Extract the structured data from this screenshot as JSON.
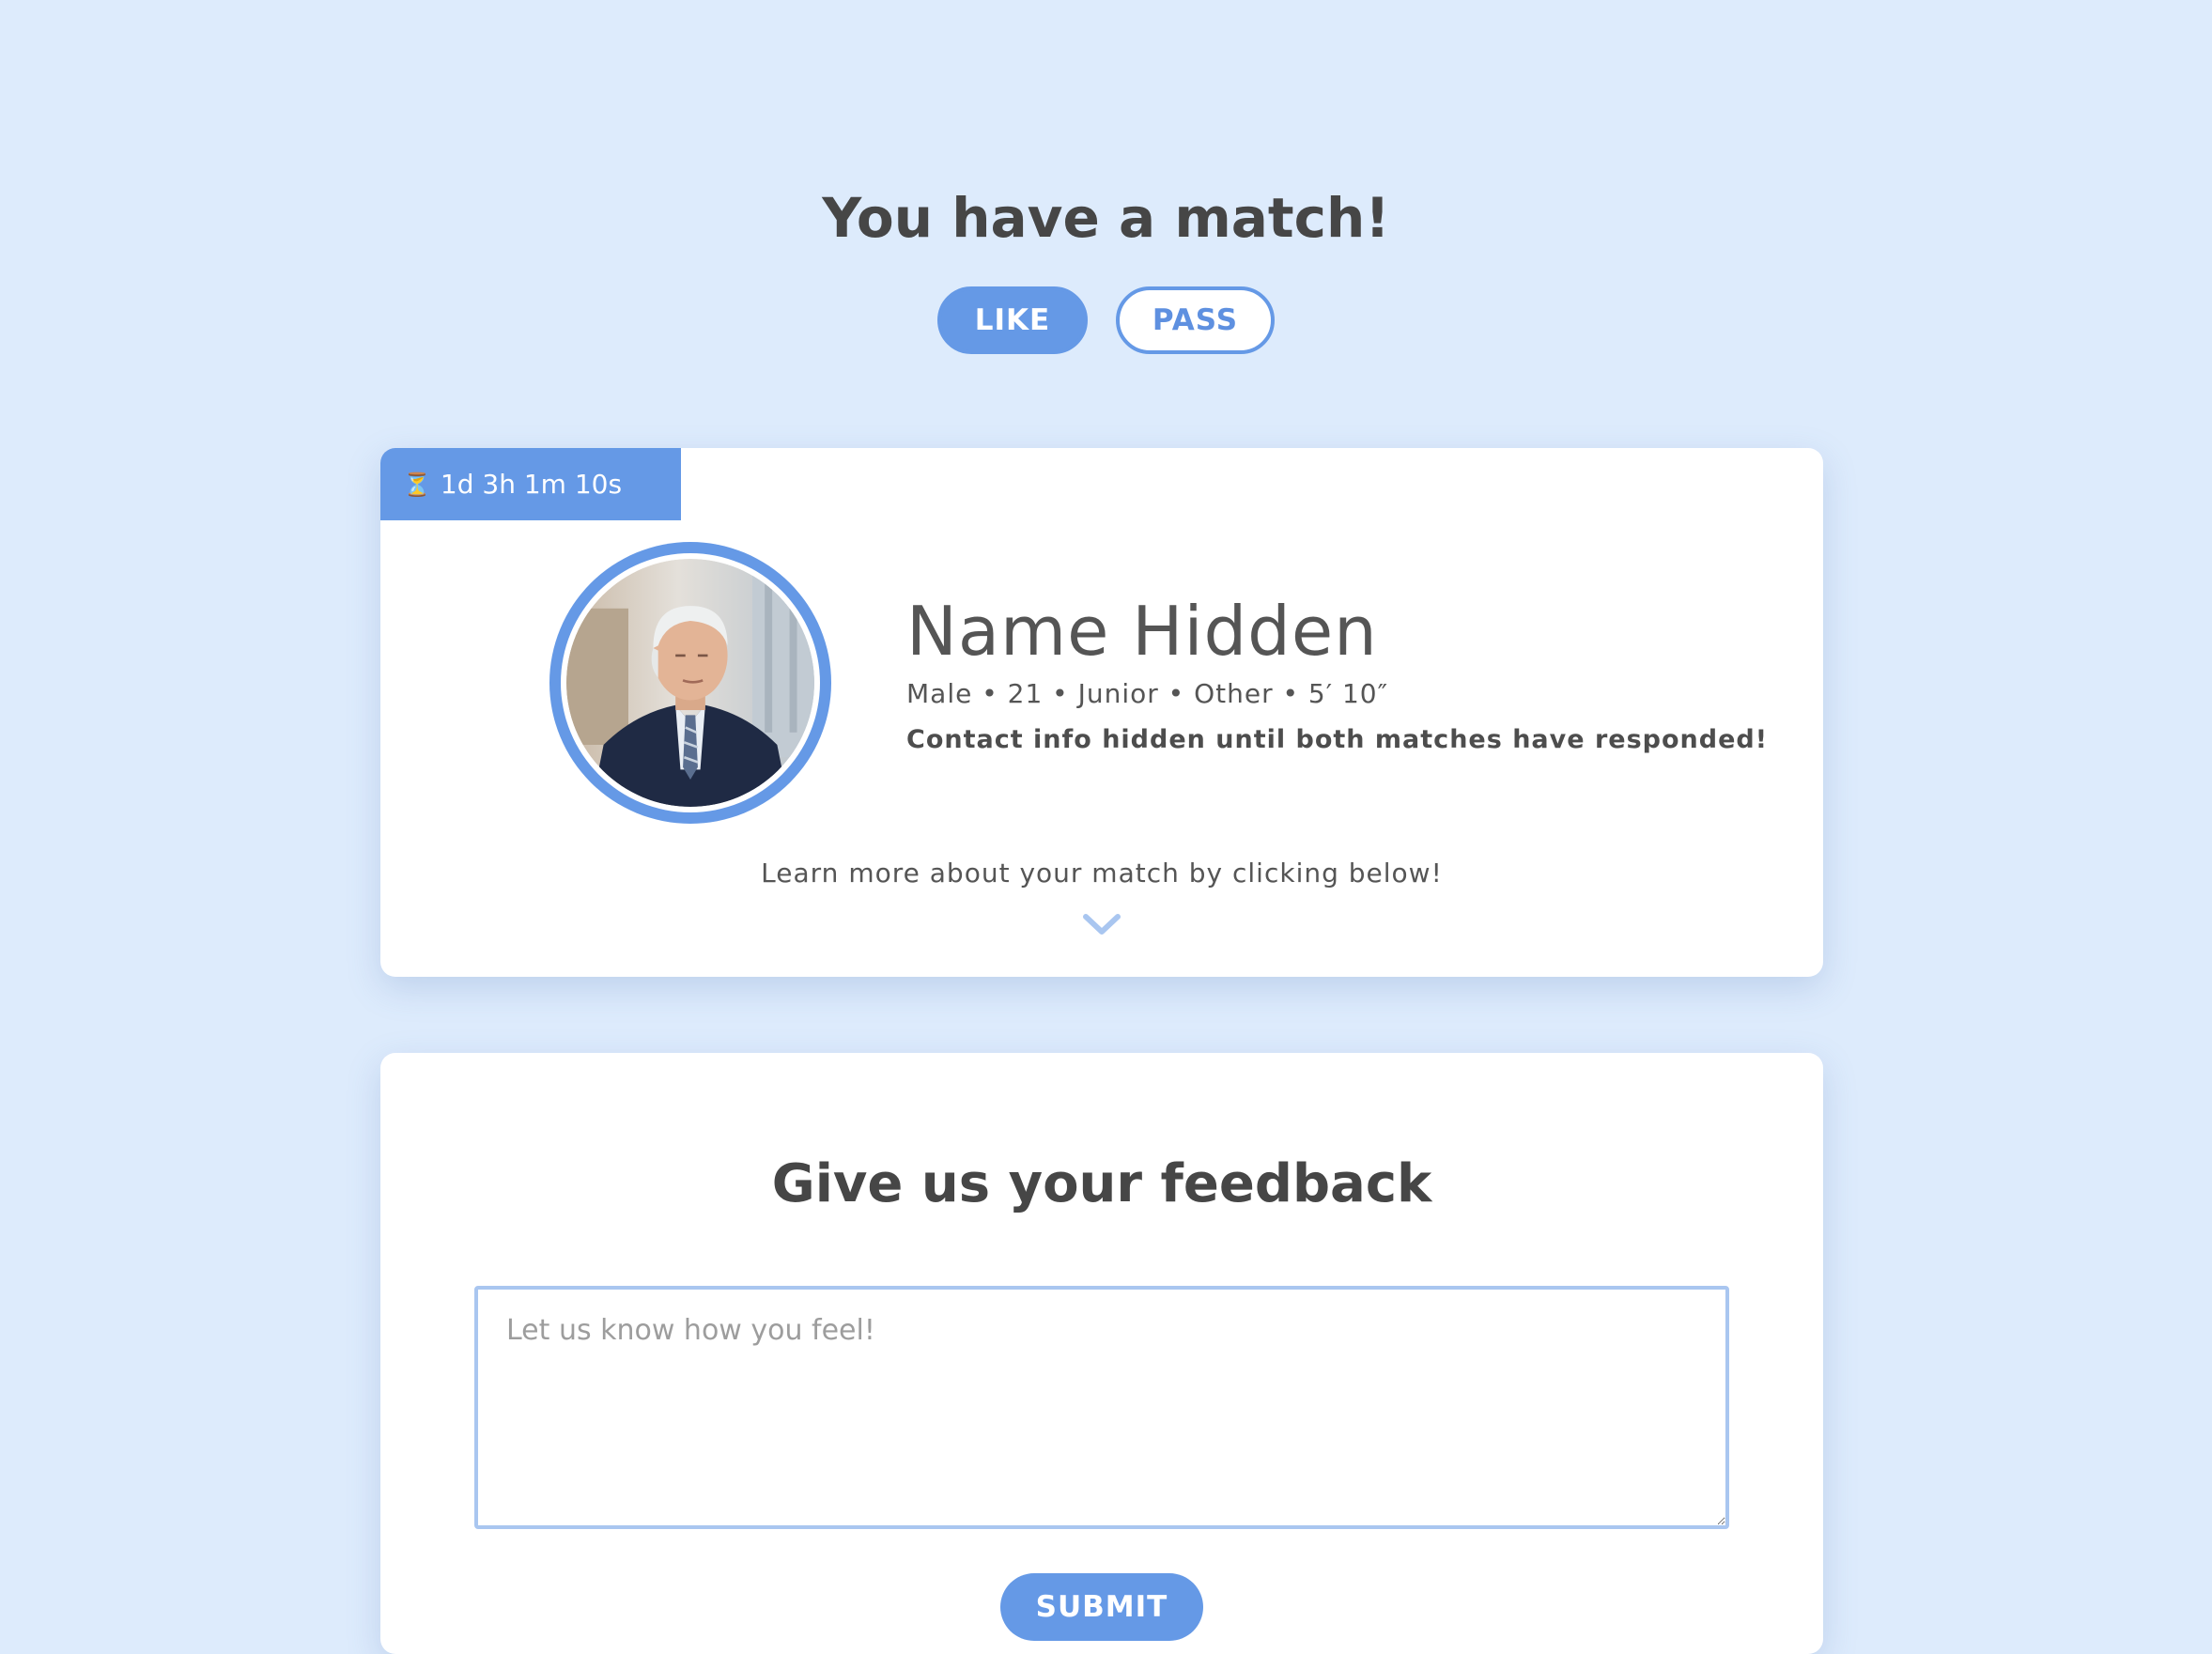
{
  "header": {
    "title": "You have a match!"
  },
  "actions": {
    "like_label": "LIKE",
    "pass_label": "PASS"
  },
  "match_card": {
    "timer": "1d 3h 1m 10s",
    "timer_icon": "hourglass-icon",
    "name": "Name Hidden",
    "details": "Male • 21 • Junior • Other • 5′ 10″",
    "contact_note": "Contact info hidden until both matches have responded!",
    "learn_more": "Learn more about your match by clicking below!",
    "expand_icon": "chevron-down-icon"
  },
  "feedback": {
    "title": "Give us your feedback",
    "placeholder": "Let us know how you feel!",
    "value": "",
    "submit_label": "SUBMIT"
  },
  "colors": {
    "background": "#ddebfc",
    "accent": "#6599e6",
    "card": "#ffffff",
    "text": "#4a4a4a"
  }
}
